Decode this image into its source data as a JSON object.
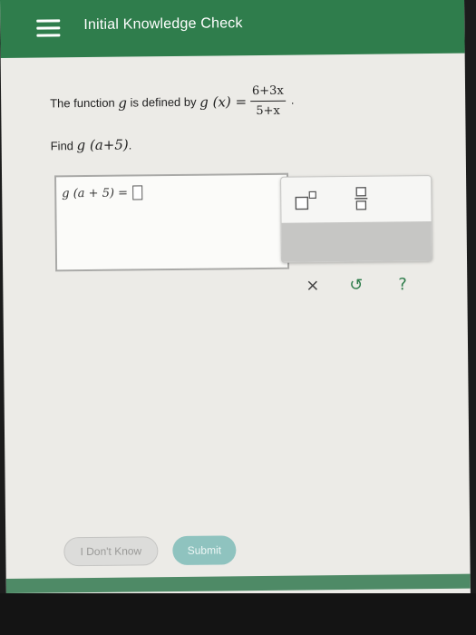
{
  "header": {
    "title": "Initial Knowledge Check",
    "menu_icon": "hamburger-icon"
  },
  "question": {
    "prefix": "The function",
    "var_g": "g",
    "middle": "is defined by",
    "func": "g (x) =",
    "numerator": "6+3x",
    "denominator": "5+x",
    "period": "."
  },
  "find": {
    "label": "Find",
    "expr": "g (a+5)",
    "period": "."
  },
  "answer": {
    "expr": "g (a + 5) ="
  },
  "palette": {
    "superscript_icon": "superscript-icon",
    "fraction_icon": "fraction-icon",
    "clear_label": "×",
    "undo_label": "↺",
    "help_label": "?"
  },
  "footer": {
    "dont_know_label": "I Don't Know",
    "submit_label": "Submit"
  },
  "colors": {
    "header": "#2f7d4c",
    "submit": "#8fc3bf",
    "undo": "#2f7d4c"
  }
}
